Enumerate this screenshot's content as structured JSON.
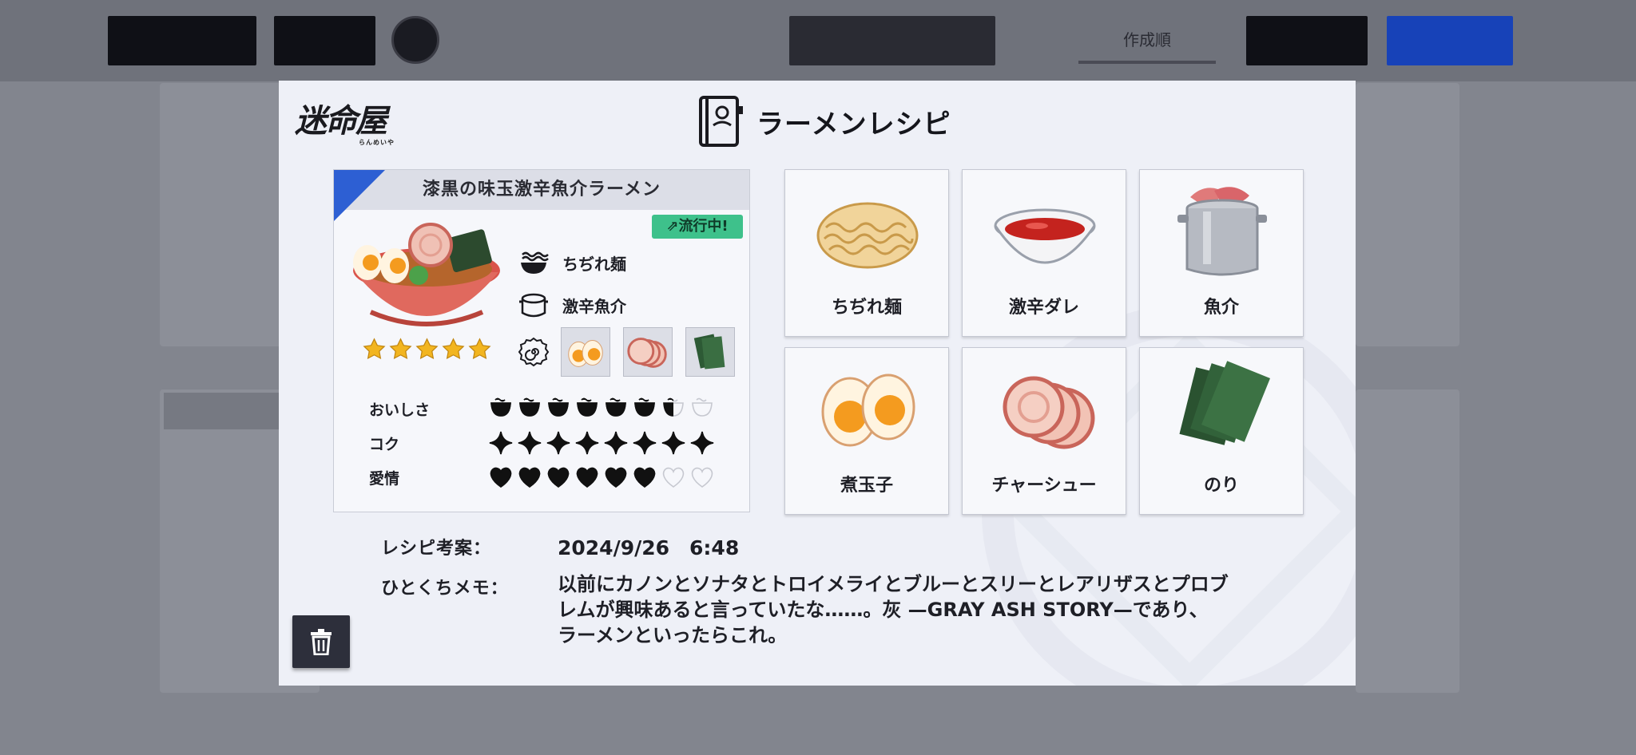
{
  "modal": {
    "logo_text": "迷命屋",
    "logo_subtext": "らんめいや",
    "title": "ラーメンレシピ"
  },
  "recipe": {
    "name": "漆黒の味玉激辛魚介ラーメン",
    "trend_badge": "流行中!",
    "rating_stars": 5,
    "noodle": "ちぢれ麺",
    "soup": "激辛魚介",
    "toppings": [
      "煮玉子",
      "チャーシュー",
      "のり"
    ],
    "stats": [
      {
        "label": "おいしさ",
        "icon": "bowl-icon",
        "value": 6.5,
        "max": 8
      },
      {
        "label": "コク",
        "icon": "sparkle-icon",
        "value": 8,
        "max": 8
      },
      {
        "label": "愛情",
        "icon": "heart-icon",
        "value": 6,
        "max": 8
      }
    ]
  },
  "ingredients": [
    {
      "label": "ちぢれ麺",
      "icon": "noodles-icon"
    },
    {
      "label": "激辛ダレ",
      "icon": "spicy-sauce-icon"
    },
    {
      "label": "魚介",
      "icon": "seafood-pot-icon"
    },
    {
      "label": "煮玉子",
      "icon": "boiled-egg-icon"
    },
    {
      "label": "チャーシュー",
      "icon": "chashu-icon"
    },
    {
      "label": "のり",
      "icon": "nori-icon"
    }
  ],
  "info": {
    "date_label": "レシピ考案：",
    "date_value": "2024/9/26　6:48",
    "memo_label": "ひとくちメモ：",
    "memo_lines": [
      "以前にカノンとソナタとトロイメライとブルーとスリーとレアリザスとプロブ",
      "レムが興味あると言っていたな……。灰 —GRAY ASH STORY—であり、",
      "ラーメンといったらこれ。"
    ]
  },
  "background": {
    "tab_label": "作成順"
  },
  "colors": {
    "accent_blue": "#2d5fd3",
    "trend_green": "#3ec18b",
    "star_gold": "#f2b520",
    "modal_bg": "#eef0f7"
  }
}
